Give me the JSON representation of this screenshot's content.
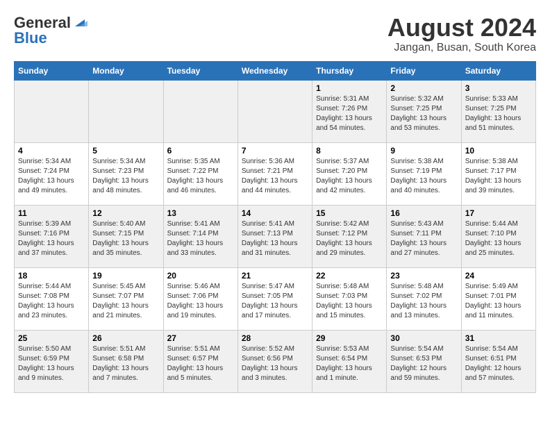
{
  "header": {
    "logo_general": "General",
    "logo_blue": "Blue",
    "month_title": "August 2024",
    "location": "Jangan, Busan, South Korea"
  },
  "days_of_week": [
    "Sunday",
    "Monday",
    "Tuesday",
    "Wednesday",
    "Thursday",
    "Friday",
    "Saturday"
  ],
  "weeks": [
    [
      {
        "day": "",
        "info": ""
      },
      {
        "day": "",
        "info": ""
      },
      {
        "day": "",
        "info": ""
      },
      {
        "day": "",
        "info": ""
      },
      {
        "day": "1",
        "info": "Sunrise: 5:31 AM\nSunset: 7:26 PM\nDaylight: 13 hours and 54 minutes."
      },
      {
        "day": "2",
        "info": "Sunrise: 5:32 AM\nSunset: 7:25 PM\nDaylight: 13 hours and 53 minutes."
      },
      {
        "day": "3",
        "info": "Sunrise: 5:33 AM\nSunset: 7:25 PM\nDaylight: 13 hours and 51 minutes."
      }
    ],
    [
      {
        "day": "4",
        "info": "Sunrise: 5:34 AM\nSunset: 7:24 PM\nDaylight: 13 hours and 49 minutes."
      },
      {
        "day": "5",
        "info": "Sunrise: 5:34 AM\nSunset: 7:23 PM\nDaylight: 13 hours and 48 minutes."
      },
      {
        "day": "6",
        "info": "Sunrise: 5:35 AM\nSunset: 7:22 PM\nDaylight: 13 hours and 46 minutes."
      },
      {
        "day": "7",
        "info": "Sunrise: 5:36 AM\nSunset: 7:21 PM\nDaylight: 13 hours and 44 minutes."
      },
      {
        "day": "8",
        "info": "Sunrise: 5:37 AM\nSunset: 7:20 PM\nDaylight: 13 hours and 42 minutes."
      },
      {
        "day": "9",
        "info": "Sunrise: 5:38 AM\nSunset: 7:19 PM\nDaylight: 13 hours and 40 minutes."
      },
      {
        "day": "10",
        "info": "Sunrise: 5:38 AM\nSunset: 7:17 PM\nDaylight: 13 hours and 39 minutes."
      }
    ],
    [
      {
        "day": "11",
        "info": "Sunrise: 5:39 AM\nSunset: 7:16 PM\nDaylight: 13 hours and 37 minutes."
      },
      {
        "day": "12",
        "info": "Sunrise: 5:40 AM\nSunset: 7:15 PM\nDaylight: 13 hours and 35 minutes."
      },
      {
        "day": "13",
        "info": "Sunrise: 5:41 AM\nSunset: 7:14 PM\nDaylight: 13 hours and 33 minutes."
      },
      {
        "day": "14",
        "info": "Sunrise: 5:41 AM\nSunset: 7:13 PM\nDaylight: 13 hours and 31 minutes."
      },
      {
        "day": "15",
        "info": "Sunrise: 5:42 AM\nSunset: 7:12 PM\nDaylight: 13 hours and 29 minutes."
      },
      {
        "day": "16",
        "info": "Sunrise: 5:43 AM\nSunset: 7:11 PM\nDaylight: 13 hours and 27 minutes."
      },
      {
        "day": "17",
        "info": "Sunrise: 5:44 AM\nSunset: 7:10 PM\nDaylight: 13 hours and 25 minutes."
      }
    ],
    [
      {
        "day": "18",
        "info": "Sunrise: 5:44 AM\nSunset: 7:08 PM\nDaylight: 13 hours and 23 minutes."
      },
      {
        "day": "19",
        "info": "Sunrise: 5:45 AM\nSunset: 7:07 PM\nDaylight: 13 hours and 21 minutes."
      },
      {
        "day": "20",
        "info": "Sunrise: 5:46 AM\nSunset: 7:06 PM\nDaylight: 13 hours and 19 minutes."
      },
      {
        "day": "21",
        "info": "Sunrise: 5:47 AM\nSunset: 7:05 PM\nDaylight: 13 hours and 17 minutes."
      },
      {
        "day": "22",
        "info": "Sunrise: 5:48 AM\nSunset: 7:03 PM\nDaylight: 13 hours and 15 minutes."
      },
      {
        "day": "23",
        "info": "Sunrise: 5:48 AM\nSunset: 7:02 PM\nDaylight: 13 hours and 13 minutes."
      },
      {
        "day": "24",
        "info": "Sunrise: 5:49 AM\nSunset: 7:01 PM\nDaylight: 13 hours and 11 minutes."
      }
    ],
    [
      {
        "day": "25",
        "info": "Sunrise: 5:50 AM\nSunset: 6:59 PM\nDaylight: 13 hours and 9 minutes."
      },
      {
        "day": "26",
        "info": "Sunrise: 5:51 AM\nSunset: 6:58 PM\nDaylight: 13 hours and 7 minutes."
      },
      {
        "day": "27",
        "info": "Sunrise: 5:51 AM\nSunset: 6:57 PM\nDaylight: 13 hours and 5 minutes."
      },
      {
        "day": "28",
        "info": "Sunrise: 5:52 AM\nSunset: 6:56 PM\nDaylight: 13 hours and 3 minutes."
      },
      {
        "day": "29",
        "info": "Sunrise: 5:53 AM\nSunset: 6:54 PM\nDaylight: 13 hours and 1 minute."
      },
      {
        "day": "30",
        "info": "Sunrise: 5:54 AM\nSunset: 6:53 PM\nDaylight: 12 hours and 59 minutes."
      },
      {
        "day": "31",
        "info": "Sunrise: 5:54 AM\nSunset: 6:51 PM\nDaylight: 12 hours and 57 minutes."
      }
    ]
  ]
}
